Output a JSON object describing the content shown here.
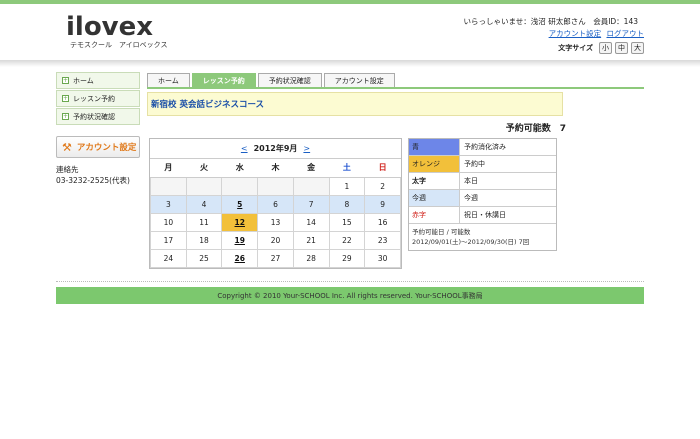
{
  "header": {
    "logo": "ilovex",
    "logo_sub": "テモスクール　アイロベックス",
    "welcome": "いらっしゃいませ：浅沼 研太郎さん　会員ID：143",
    "account_settings_link": "アカウント設定",
    "logout_link": "ログアウト",
    "fontsize_label": "文字サイズ",
    "fontsize_small": "小",
    "fontsize_medium": "中",
    "fontsize_large": "大"
  },
  "sidebar": {
    "items": [
      {
        "label": "ホーム"
      },
      {
        "label": "レッスン予約"
      },
      {
        "label": "予約状況確認"
      }
    ],
    "account_button": "アカウント設定",
    "contact_label": "連絡先",
    "contact_phone": "03-3232-2525(代表)"
  },
  "tabs": [
    {
      "label": "ホーム"
    },
    {
      "label": "レッスン予約"
    },
    {
      "label": "予約状況確認"
    },
    {
      "label": "アカウント設定"
    }
  ],
  "course": "新宿校 英会話ビジネスコース",
  "reservable": "予約可能数　7",
  "calendar": {
    "prev": "<",
    "title": "2012年9月",
    "next": ">",
    "weekdays": [
      "月",
      "火",
      "水",
      "木",
      "金",
      "土",
      "日"
    ],
    "weeks": [
      [
        "",
        "",
        "",
        "",
        "",
        "1",
        "2"
      ],
      [
        "3",
        "4",
        "5",
        "6",
        "7",
        "8",
        "9"
      ],
      [
        "10",
        "11",
        "12",
        "13",
        "14",
        "15",
        "16"
      ],
      [
        "17",
        "18",
        "19",
        "20",
        "21",
        "22",
        "23"
      ],
      [
        "24",
        "25",
        "26",
        "27",
        "28",
        "29",
        "30"
      ]
    ]
  },
  "legend": {
    "rows": [
      {
        "key": "青",
        "value": "予約消化済み",
        "bg": "#6d86e8",
        "color": "#000000"
      },
      {
        "key": "オレンジ",
        "value": "予約中",
        "bg": "#f2c03a",
        "color": "#000000"
      },
      {
        "key": "太字",
        "value": "本日",
        "bg": "#ffffff",
        "color": "#000000"
      },
      {
        "key": "今週",
        "value": "今週",
        "bg": "#d6e6f8",
        "color": "#000000"
      },
      {
        "key": "赤字",
        "value": "祝日・休講日",
        "bg": "#ffffff",
        "color": "#d0201a"
      }
    ],
    "note_line1": "予約可能日 / 可能数",
    "note_line2": "2012/09/01(土)〜2012/09/30(日) 7回"
  },
  "footer": "Copyright © 2010 Your-SCHOOL Inc. All rights reserved. Your-SCHOOL事務局",
  "colors": {
    "accent": "#8dc97b",
    "link": "#1a5fc4",
    "today": "#f2c03a",
    "this_week": "#d6e6f8"
  }
}
